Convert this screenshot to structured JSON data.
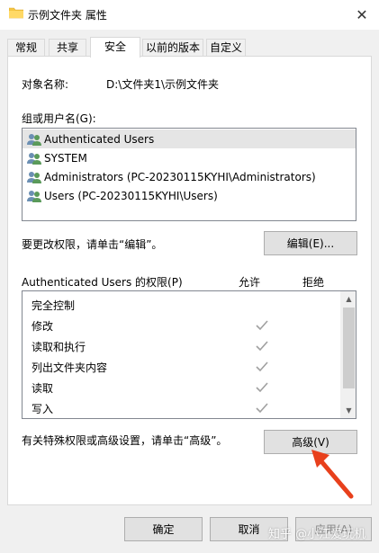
{
  "window": {
    "title": "示例文件夹 属性",
    "close_glyph": "✕"
  },
  "tabs": [
    {
      "label": "常规",
      "active": false
    },
    {
      "label": "共享",
      "active": false
    },
    {
      "label": "安全",
      "active": true
    },
    {
      "label": "以前的版本",
      "active": false
    },
    {
      "label": "自定义",
      "active": false
    }
  ],
  "security": {
    "object_name_label": "对象名称:",
    "object_name_value": "D:\\文件夹1\\示例文件夹",
    "groups_label": "组或用户名(G):",
    "users": [
      {
        "name": "Authenticated Users",
        "selected": true
      },
      {
        "name": "SYSTEM",
        "selected": false
      },
      {
        "name": "Administrators (PC-20230115KYHI\\Administrators)",
        "selected": false
      },
      {
        "name": "Users (PC-20230115KYHI\\Users)",
        "selected": false
      }
    ],
    "edit_hint": "要更改权限，请单击“编辑”。",
    "edit_button": "编辑(E)...",
    "permissions_label": "Authenticated Users 的权限(P)",
    "allow_header": "允许",
    "deny_header": "拒绝",
    "permissions": [
      {
        "name": "完全控制",
        "allow": false
      },
      {
        "name": "修改",
        "allow": true
      },
      {
        "name": "读取和执行",
        "allow": true
      },
      {
        "name": "列出文件夹内容",
        "allow": true
      },
      {
        "name": "读取",
        "allow": true
      },
      {
        "name": "写入",
        "allow": true
      }
    ],
    "advanced_hint": "有关特殊权限或高级设置，请单击“高级”。",
    "advanced_button": "高级(V)"
  },
  "footer": {
    "ok_button": "确定",
    "cancel_button": "取消",
    "apply_button": "应用(A)"
  },
  "watermark": "知乎 @小江爱玩机",
  "colors": {
    "window_bg": "#f0f0f0",
    "panel_bg": "#ffffff",
    "selected_row": "#e5e5e5",
    "arrow": "#e8401c",
    "check": "#a0a0a0"
  }
}
